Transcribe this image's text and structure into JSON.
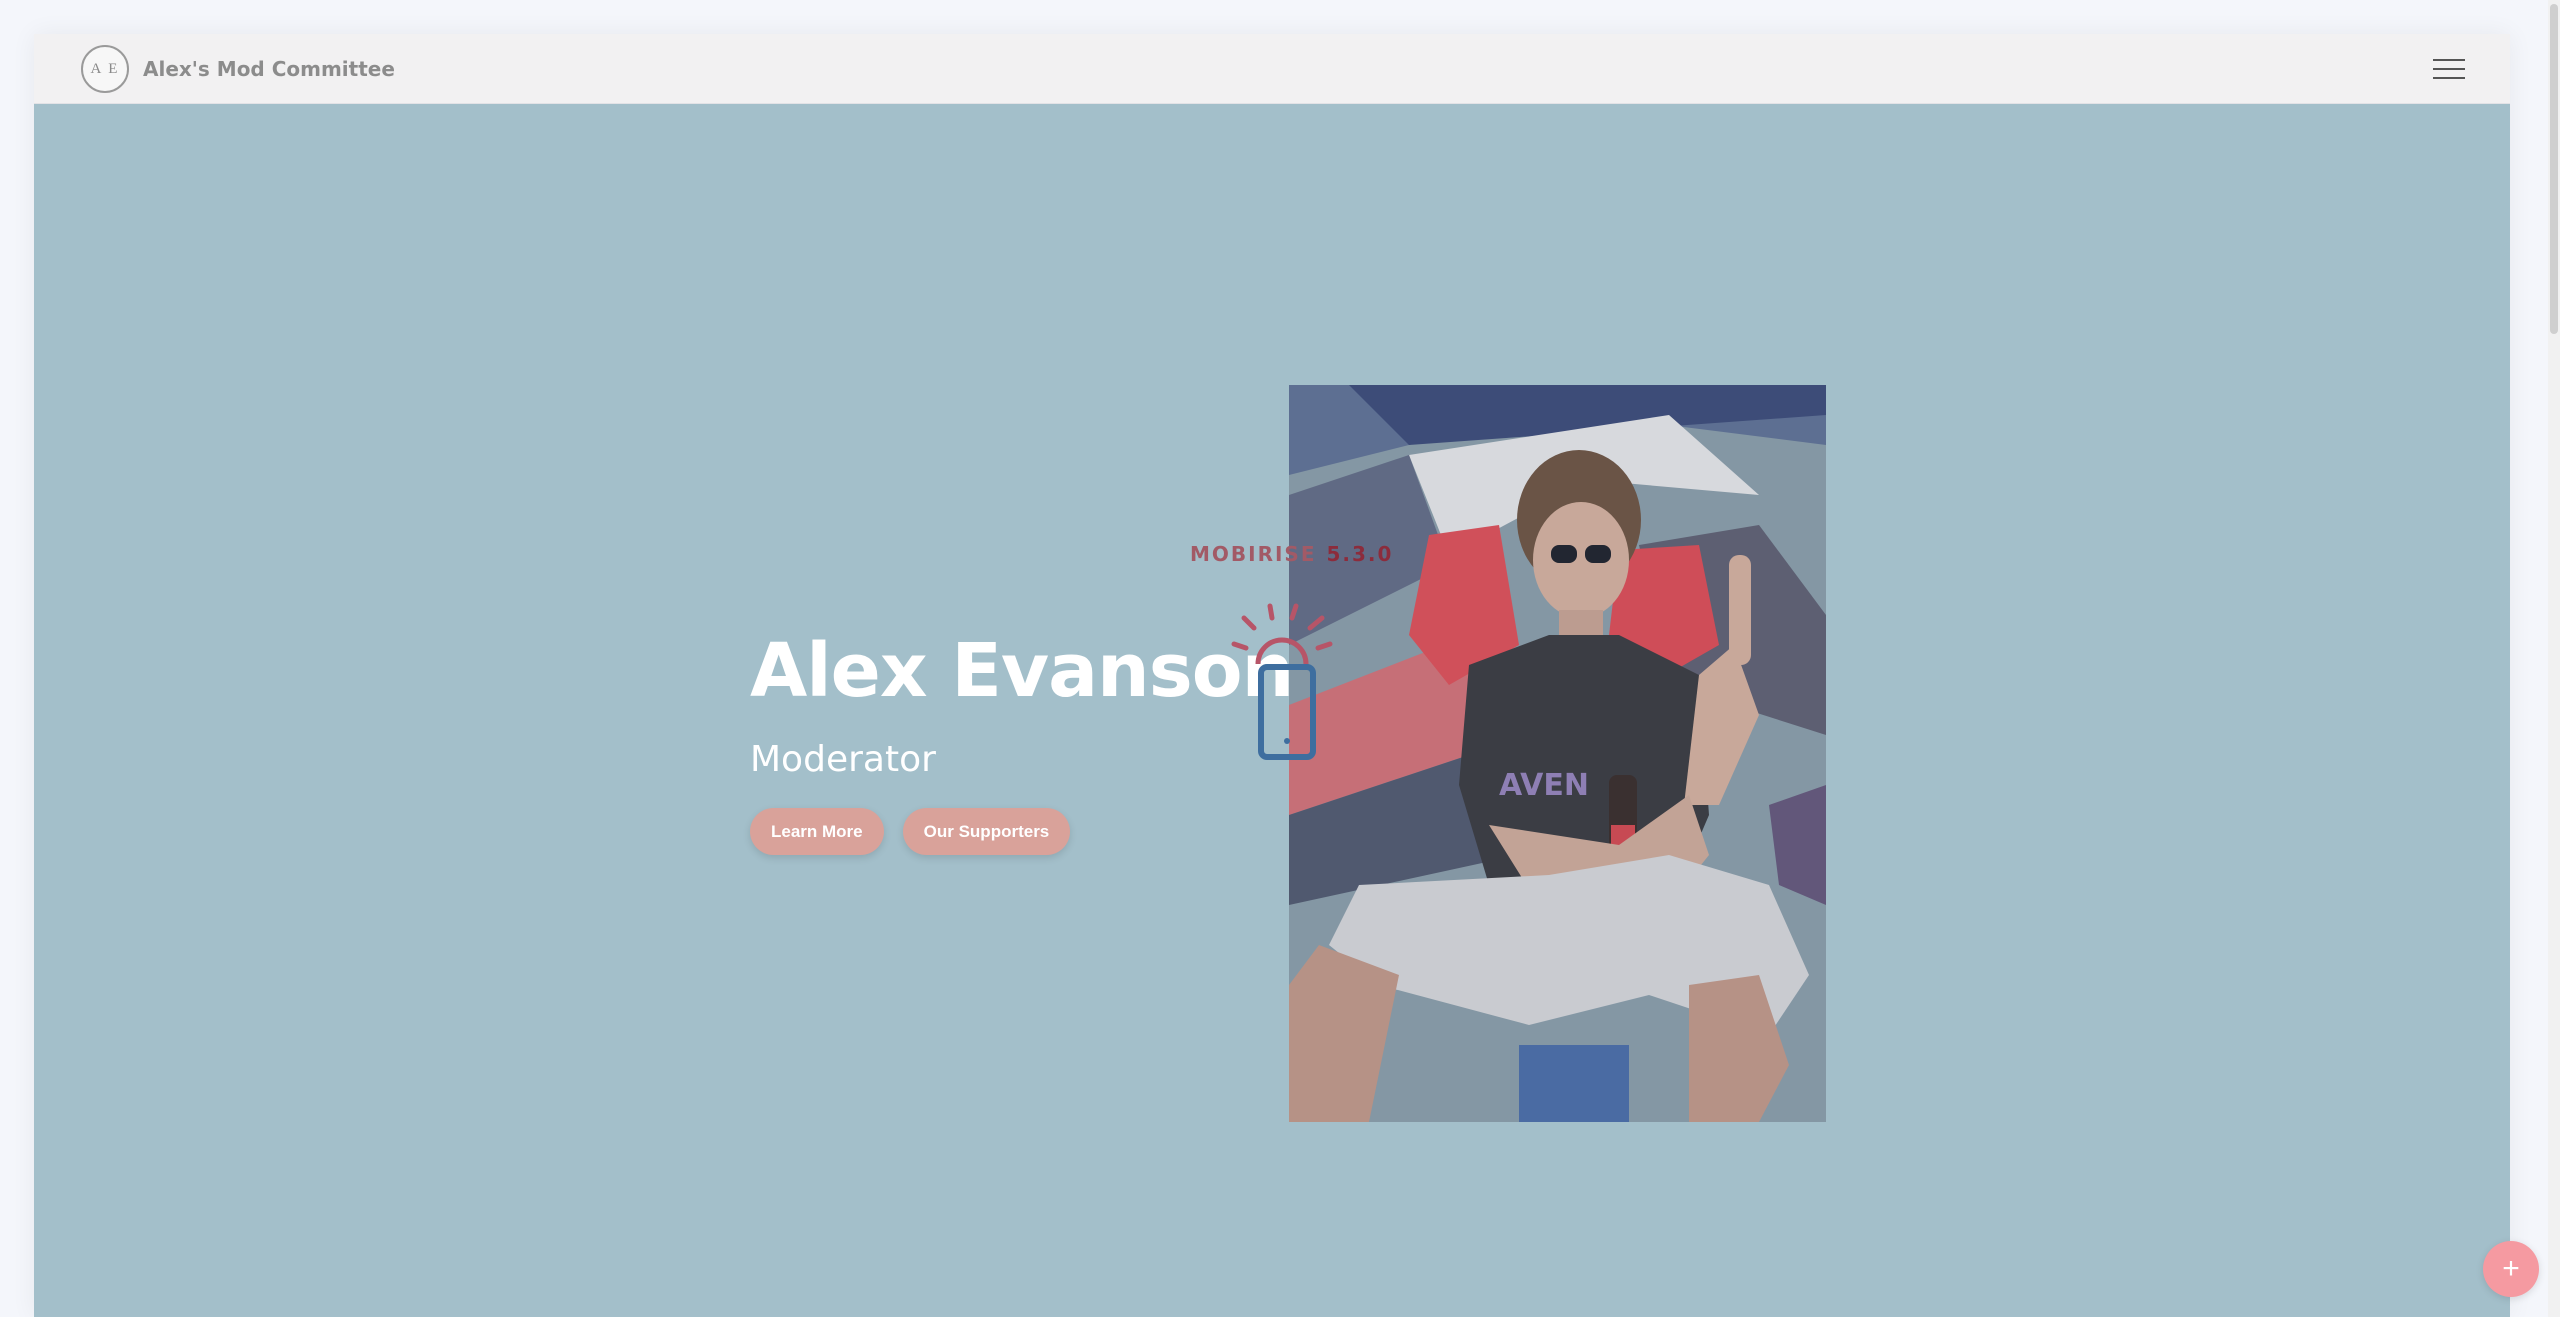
{
  "navbar": {
    "logo_text": "A E",
    "brand": "Alex's Mod Committee",
    "menu_icon": "hamburger-menu-icon"
  },
  "hero": {
    "name": "Alex Evanson",
    "role": "Moderator",
    "buttons": {
      "learn_more": "Learn More",
      "supporters": "Our Supporters"
    }
  },
  "loader": {
    "brand": "MOBIRISE",
    "version": "5.3.0",
    "icon": "phone-with-rays-icon"
  },
  "fab": {
    "label": "+",
    "icon": "plus-icon"
  },
  "colors": {
    "page_background": "#f4f6fb",
    "hero_background": "#a3bfca",
    "navbar": "#f2f1f2",
    "button": "#d9a29a",
    "fab": "#f59aa1",
    "loader_text": "#a25a66",
    "loader_phone": "#3e6e9f"
  }
}
